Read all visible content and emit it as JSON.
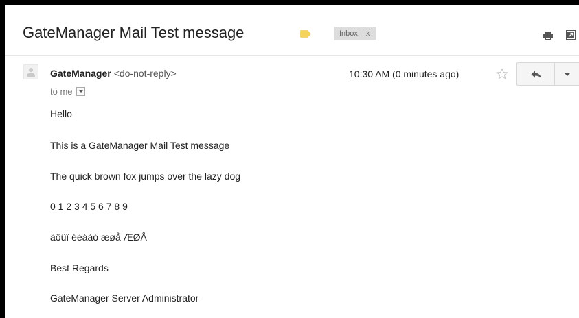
{
  "email": {
    "subject": "GateManager Mail Test message",
    "label": "Inbox",
    "label_close": "x",
    "sender_name": "GateManager",
    "sender_email": "<do-not-reply>",
    "recipient": "to me",
    "timestamp": "10:30 AM (0 minutes ago)",
    "body": [
      "Hello",
      "This is a GateManager Mail Test message",
      "The quick brown fox jumps over the lazy dog",
      "0 1 2 3 4 5 6 7 8 9",
      "äöüï éèáàó æøå ÆØÅ",
      "Best Regards",
      "GateManager Server Administrator"
    ]
  },
  "icons": {
    "label_tag": "label-tag-icon",
    "print": "print-icon",
    "new_window": "new-window-icon",
    "avatar": "avatar-icon",
    "star": "star-icon",
    "reply": "reply-icon",
    "more": "chevron-down-icon"
  },
  "colors": {
    "label_tag": "#f4d45a",
    "label_chip_bg": "#dddddd",
    "star_outline": "#c7c7c7"
  }
}
